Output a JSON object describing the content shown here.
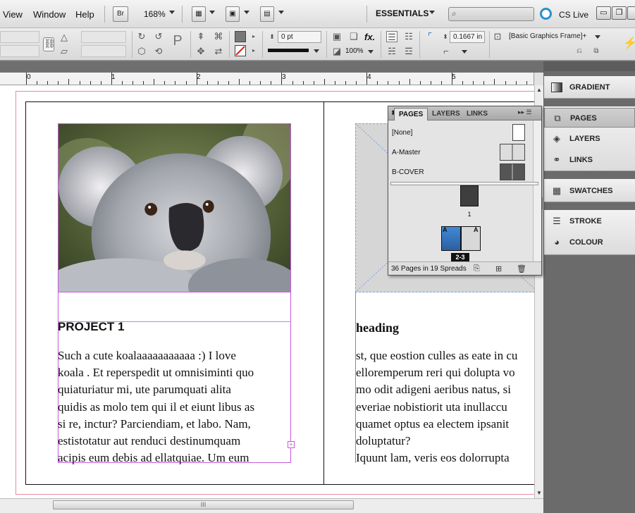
{
  "menubar": {
    "items": [
      "View",
      "Window",
      "Help"
    ],
    "bridge_label": "Br",
    "zoom": "168%",
    "workspace": "ESSENTIALS",
    "cs_live": "CS Live",
    "win_buttons": [
      "▭",
      "❐",
      "✕"
    ]
  },
  "controlbar": {
    "stroke_weight": "0 pt",
    "opacity": "100%",
    "fx_label": "fx.",
    "dimension": "0.1667 in",
    "object_style": "[Basic Graphics Frame]+",
    "colors": {
      "fill": "#777777",
      "stroke_none": "#d92020"
    }
  },
  "ruler": {
    "labels": [
      "0",
      "1",
      "2",
      "3",
      "4",
      "5"
    ]
  },
  "document": {
    "left_page": {
      "heading": "PROJECT 1",
      "body": "Such a cute koalaaaaaaaaaaa :) I love\nkoala . Et reperspedit ut omnisiminti quo\nquiaturiatur mi, ute parumquati alita\nquidis as molo tem qui il et eiunt libus as\nsi re, inctur? Parciendiam, et labo. Nam,\nestistotatur aut renduci destinumquam\nacipis eum debis ad ellatquiae. Um eum",
      "overset_marker": "+"
    },
    "right_page": {
      "heading": "heading",
      "body": "st, que eostion culles as eate in cu\nelloremperum reri qui dolupta vo\nmo odit adigeni aeribus natus, si\neveriae nobistiorit uta inullaccu\nquamet optus ea electem ipsanit\ndoluptatur?\nIquunt lam, veris eos dolorrupta"
    }
  },
  "pages_panel": {
    "tabs": [
      "PAGES",
      "LAYERS",
      "LINKS"
    ],
    "masters": [
      "[None]",
      "A-Master",
      "B-COVER"
    ],
    "page_1_label": "1",
    "spread_label": "2-3",
    "master_prefix": "A",
    "footer": "36 Pages in 19 Spreads"
  },
  "dock": {
    "groups": [
      {
        "items": [
          {
            "label": "GRADIENT",
            "icon": "gradient-icon"
          }
        ]
      },
      {
        "items": [
          {
            "label": "PAGES",
            "icon": "pages-icon"
          },
          {
            "label": "LAYERS",
            "icon": "layers-icon"
          },
          {
            "label": "LINKS",
            "icon": "links-icon"
          }
        ]
      },
      {
        "items": [
          {
            "label": "SWATCHES",
            "icon": "swatches-icon"
          }
        ]
      },
      {
        "items": [
          {
            "label": "STROKE",
            "icon": "stroke-icon"
          },
          {
            "label": "COLOUR",
            "icon": "colour-icon"
          }
        ]
      }
    ]
  },
  "scroll": {
    "h_thumb_grip": "III"
  }
}
